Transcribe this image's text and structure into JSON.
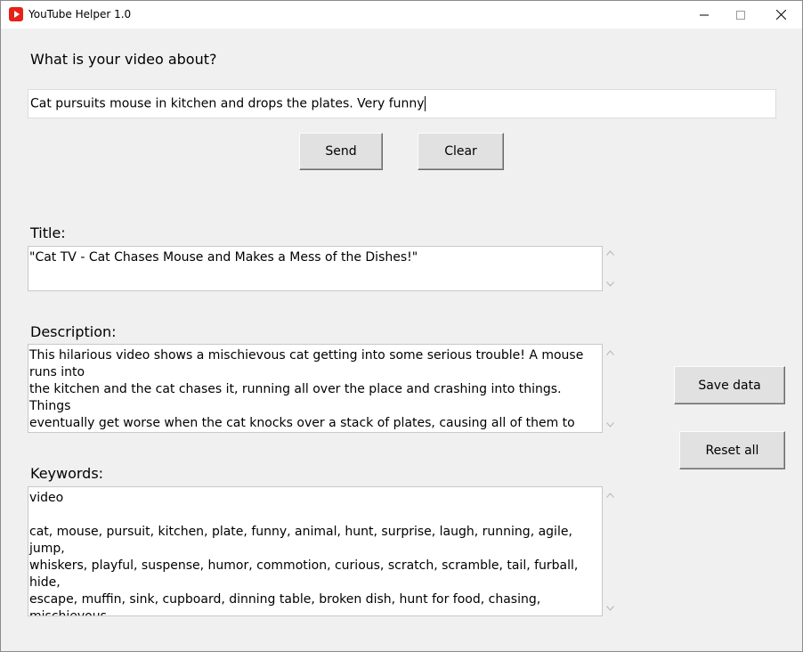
{
  "window": {
    "title": "YouTube Helper 1.0",
    "controls": {
      "minimize": "—",
      "maximize": "□",
      "close": "✕"
    },
    "icon": "youtube-play-icon",
    "icon_color": "#e62117"
  },
  "prompt": {
    "label": "What is your video about?",
    "value": "Cat pursuits mouse in kitchen and drops the plates. Very funny"
  },
  "buttons": {
    "send": "Send",
    "clear": "Clear",
    "save": "Save data",
    "reset": "Reset all"
  },
  "title_section": {
    "label": "Title:",
    "text": "\"Cat TV - Cat Chases Mouse and Makes a Mess of the Dishes!\""
  },
  "description_section": {
    "label": "Description:",
    "text": "This hilarious video shows a mischievous cat getting into some serious trouble! A mouse runs into\nthe kitchen and the cat chases it, running all over the place and crashing into things. Things\neventually get worse when the cat knocks over a stack of plates, causing all of them to shatter on\nthe floor. You don't want to miss this funny clip that will definitely make you laugh."
  },
  "keywords_section": {
    "label": "Keywords:",
    "text": "video\n\ncat, mouse, pursuit, kitchen, plate, funny, animal, hunt, surprise, laugh, running, agile, jump,\nwhiskers, playful, suspense, humor, commotion, curious, scratch, scramble, tail, furball, hide,\nescape, muffin, sink, cupboard, dinning table, broken dish, hunt for food, chasing, mischievous,\nbobbing, weaving, pantry, intrude, timid, messy"
  }
}
